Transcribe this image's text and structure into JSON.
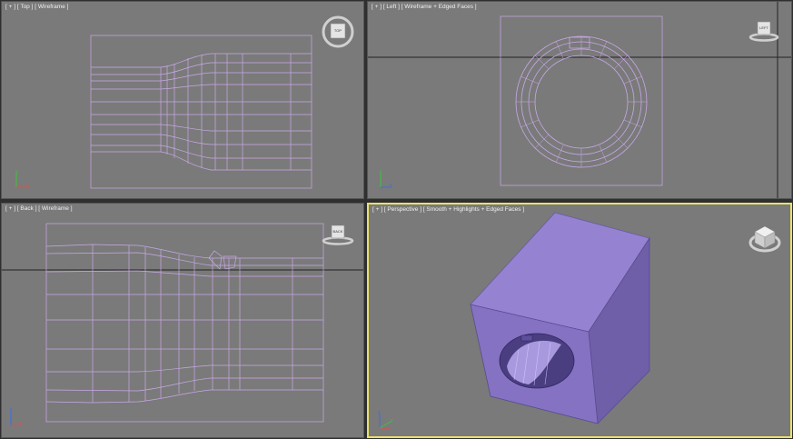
{
  "viewports": {
    "top": {
      "label": "[ + ] [ Top ] [ Wireframe ]",
      "cube_label": "TOP"
    },
    "left": {
      "label": "[ + ] [ Left ] [ Wireframe + Edged Faces ]",
      "cube_label": "LEFT"
    },
    "back": {
      "label": "[ + ] [ Back ] [ Wireframe ]",
      "cube_label": "BACK"
    },
    "perspective": {
      "label": "[ + ] [ Perspective ] [ Smooth + Highlights + Edged Faces ]"
    }
  },
  "colors": {
    "viewport_bg": "#7a7a7a",
    "wire": "#c9a8e8",
    "active_border": "#e8e070",
    "solid_face": "#8f7ac8"
  },
  "axes": {
    "x": "x",
    "y": "y",
    "z": "z"
  }
}
